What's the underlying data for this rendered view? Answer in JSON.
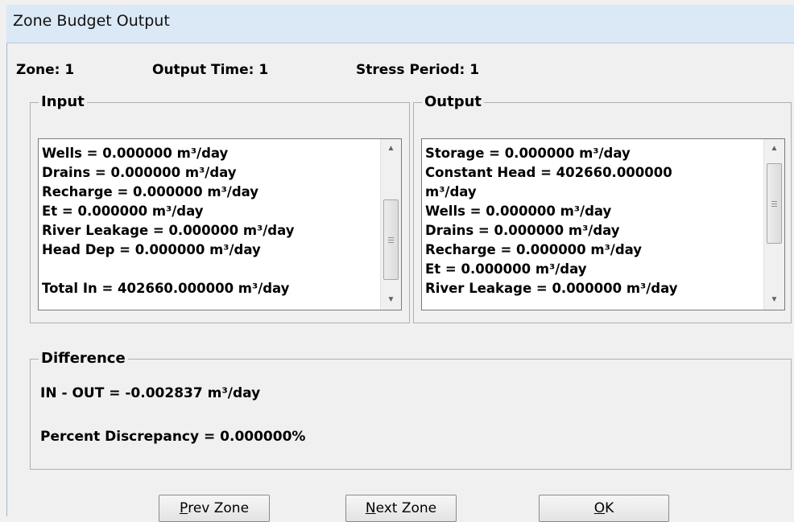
{
  "window": {
    "title": "Zone Budget Output"
  },
  "header": {
    "zone": "Zone: 1",
    "output_time": "Output Time: 1",
    "stress_period": "Stress Period: 1"
  },
  "input": {
    "legend": "Input",
    "lines": [
      "Wells = 0.000000 m³/day",
      "Drains = 0.000000 m³/day",
      "Recharge = 0.000000 m³/day",
      "Et = 0.000000 m³/day",
      "River Leakage = 0.000000 m³/day",
      "Head Dep = 0.000000 m³/day",
      "",
      "Total In = 402660.000000 m³/day"
    ],
    "scroll_fraction": 0.8
  },
  "output": {
    "legend": "Output",
    "lines": [
      "Storage = 0.000000 m³/day",
      "Constant Head = 402660.000000",
      "m³/day",
      "Wells = 0.000000 m³/day",
      "Drains = 0.000000 m³/day",
      "Recharge = 0.000000 m³/day",
      "Et = 0.000000 m³/day",
      "River Leakage = 0.000000 m³/day"
    ],
    "scroll_fraction": 0.1
  },
  "difference": {
    "legend": "Difference",
    "in_out": "IN - OUT = -0.002837 m³/day",
    "percent_discrepancy": "Percent Discrepancy = 0.000000%"
  },
  "buttons": {
    "prev": {
      "mnemonic": "P",
      "rest": "rev Zone"
    },
    "next": {
      "mnemonic": "N",
      "rest": "ext Zone"
    },
    "ok": {
      "mnemonic": "O",
      "rest": "K"
    }
  }
}
